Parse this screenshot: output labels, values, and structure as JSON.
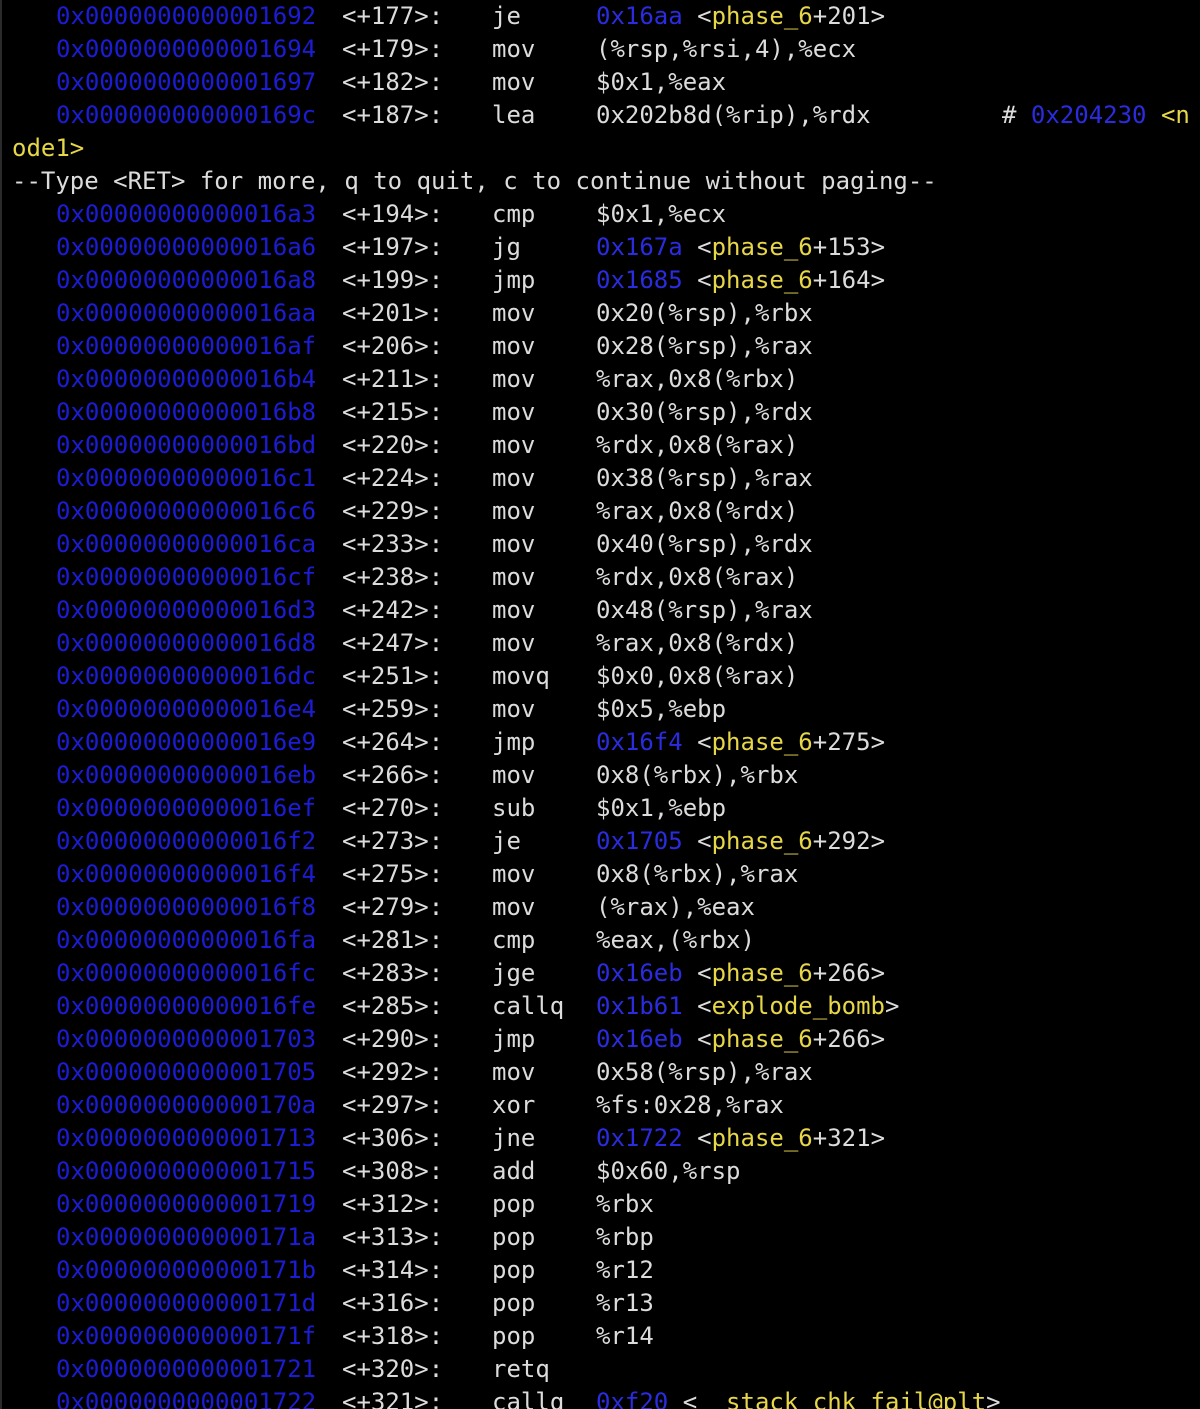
{
  "terminal": {
    "lines": [
      {
        "kind": "asm",
        "addr": "0x0000000000001692",
        "off": "<+177>:",
        "mnem": "je",
        "target": "0x16aa",
        "sym": "phase_6",
        "symoff": "+201>"
      },
      {
        "kind": "asm",
        "addr": "0x0000000000001694",
        "off": "<+179>:",
        "mnem": "mov",
        "ops": "(%rsp,%rsi,4),%ecx"
      },
      {
        "kind": "asm",
        "addr": "0x0000000000001697",
        "off": "<+182>:",
        "mnem": "mov",
        "ops": "$0x1,%eax"
      },
      {
        "kind": "asm",
        "addr": "0x000000000000169c",
        "off": "<+187>:",
        "mnem": "lea",
        "ops": "0x202b8d(%rip),%rdx",
        "comment_hash": "#",
        "comment_addr": "0x204230",
        "comment_sym": "<n"
      },
      {
        "kind": "wrap",
        "text": "ode1>"
      },
      {
        "kind": "plain",
        "text": "--Type <RET> for more, q to quit, c to continue without paging--"
      },
      {
        "kind": "asm",
        "addr": "0x00000000000016a3",
        "off": "<+194>:",
        "mnem": "cmp",
        "ops": "$0x1,%ecx"
      },
      {
        "kind": "asm",
        "addr": "0x00000000000016a6",
        "off": "<+197>:",
        "mnem": "jg",
        "target": "0x167a",
        "sym": "phase_6",
        "symoff": "+153>"
      },
      {
        "kind": "asm",
        "addr": "0x00000000000016a8",
        "off": "<+199>:",
        "mnem": "jmp",
        "target": "0x1685",
        "sym": "phase_6",
        "symoff": "+164>"
      },
      {
        "kind": "asm",
        "addr": "0x00000000000016aa",
        "off": "<+201>:",
        "mnem": "mov",
        "ops": "0x20(%rsp),%rbx"
      },
      {
        "kind": "asm",
        "addr": "0x00000000000016af",
        "off": "<+206>:",
        "mnem": "mov",
        "ops": "0x28(%rsp),%rax"
      },
      {
        "kind": "asm",
        "addr": "0x00000000000016b4",
        "off": "<+211>:",
        "mnem": "mov",
        "ops": "%rax,0x8(%rbx)"
      },
      {
        "kind": "asm",
        "addr": "0x00000000000016b8",
        "off": "<+215>:",
        "mnem": "mov",
        "ops": "0x30(%rsp),%rdx"
      },
      {
        "kind": "asm",
        "addr": "0x00000000000016bd",
        "off": "<+220>:",
        "mnem": "mov",
        "ops": "%rdx,0x8(%rax)"
      },
      {
        "kind": "asm",
        "addr": "0x00000000000016c1",
        "off": "<+224>:",
        "mnem": "mov",
        "ops": "0x38(%rsp),%rax"
      },
      {
        "kind": "asm",
        "addr": "0x00000000000016c6",
        "off": "<+229>:",
        "mnem": "mov",
        "ops": "%rax,0x8(%rdx)"
      },
      {
        "kind": "asm",
        "addr": "0x00000000000016ca",
        "off": "<+233>:",
        "mnem": "mov",
        "ops": "0x40(%rsp),%rdx"
      },
      {
        "kind": "asm",
        "addr": "0x00000000000016cf",
        "off": "<+238>:",
        "mnem": "mov",
        "ops": "%rdx,0x8(%rax)"
      },
      {
        "kind": "asm",
        "addr": "0x00000000000016d3",
        "off": "<+242>:",
        "mnem": "mov",
        "ops": "0x48(%rsp),%rax"
      },
      {
        "kind": "asm",
        "addr": "0x00000000000016d8",
        "off": "<+247>:",
        "mnem": "mov",
        "ops": "%rax,0x8(%rdx)"
      },
      {
        "kind": "asm",
        "addr": "0x00000000000016dc",
        "off": "<+251>:",
        "mnem": "movq",
        "ops": "$0x0,0x8(%rax)"
      },
      {
        "kind": "asm",
        "addr": "0x00000000000016e4",
        "off": "<+259>:",
        "mnem": "mov",
        "ops": "$0x5,%ebp"
      },
      {
        "kind": "asm",
        "addr": "0x00000000000016e9",
        "off": "<+264>:",
        "mnem": "jmp",
        "target": "0x16f4",
        "sym": "phase_6",
        "symoff": "+275>"
      },
      {
        "kind": "asm",
        "addr": "0x00000000000016eb",
        "off": "<+266>:",
        "mnem": "mov",
        "ops": "0x8(%rbx),%rbx"
      },
      {
        "kind": "asm",
        "addr": "0x00000000000016ef",
        "off": "<+270>:",
        "mnem": "sub",
        "ops": "$0x1,%ebp"
      },
      {
        "kind": "asm",
        "addr": "0x00000000000016f2",
        "off": "<+273>:",
        "mnem": "je",
        "target": "0x1705",
        "sym": "phase_6",
        "symoff": "+292>"
      },
      {
        "kind": "asm",
        "addr": "0x00000000000016f4",
        "off": "<+275>:",
        "mnem": "mov",
        "ops": "0x8(%rbx),%rax"
      },
      {
        "kind": "asm",
        "addr": "0x00000000000016f8",
        "off": "<+279>:",
        "mnem": "mov",
        "ops": "(%rax),%eax"
      },
      {
        "kind": "asm",
        "addr": "0x00000000000016fa",
        "off": "<+281>:",
        "mnem": "cmp",
        "ops": "%eax,(%rbx)"
      },
      {
        "kind": "asm",
        "addr": "0x00000000000016fc",
        "off": "<+283>:",
        "mnem": "jge",
        "target": "0x16eb",
        "sym": "phase_6",
        "symoff": "+266>"
      },
      {
        "kind": "asm",
        "addr": "0x00000000000016fe",
        "off": "<+285>:",
        "mnem": "callq",
        "target": "0x1b61",
        "sym": "explode_bomb",
        "symoff": ">"
      },
      {
        "kind": "asm",
        "addr": "0x0000000000001703",
        "off": "<+290>:",
        "mnem": "jmp",
        "target": "0x16eb",
        "sym": "phase_6",
        "symoff": "+266>"
      },
      {
        "kind": "asm",
        "addr": "0x0000000000001705",
        "off": "<+292>:",
        "mnem": "mov",
        "ops": "0x58(%rsp),%rax"
      },
      {
        "kind": "asm",
        "addr": "0x000000000000170a",
        "off": "<+297>:",
        "mnem": "xor",
        "ops": "%fs:0x28,%rax"
      },
      {
        "kind": "asm",
        "addr": "0x0000000000001713",
        "off": "<+306>:",
        "mnem": "jne",
        "target": "0x1722",
        "sym": "phase_6",
        "symoff": "+321>"
      },
      {
        "kind": "asm",
        "addr": "0x0000000000001715",
        "off": "<+308>:",
        "mnem": "add",
        "ops": "$0x60,%rsp"
      },
      {
        "kind": "asm",
        "addr": "0x0000000000001719",
        "off": "<+312>:",
        "mnem": "pop",
        "ops": "%rbx"
      },
      {
        "kind": "asm",
        "addr": "0x000000000000171a",
        "off": "<+313>:",
        "mnem": "pop",
        "ops": "%rbp"
      },
      {
        "kind": "asm",
        "addr": "0x000000000000171b",
        "off": "<+314>:",
        "mnem": "pop",
        "ops": "%r12"
      },
      {
        "kind": "asm",
        "addr": "0x000000000000171d",
        "off": "<+316>:",
        "mnem": "pop",
        "ops": "%r13"
      },
      {
        "kind": "asm",
        "addr": "0x000000000000171f",
        "off": "<+318>:",
        "mnem": "pop",
        "ops": "%r14"
      },
      {
        "kind": "asm",
        "addr": "0x0000000000001721",
        "off": "<+320>:",
        "mnem": "retq"
      },
      {
        "kind": "asm",
        "addr": "0x0000000000001722",
        "off": "<+321>:",
        "mnem": "callq",
        "target": "0xf20",
        "sym": "__stack_chk_fail@plt",
        "symoff": ">"
      }
    ]
  },
  "colors": {
    "background": "#000000",
    "text": "#dcdcdc",
    "address": "#1c1cd6",
    "symbol": "#e6d648"
  }
}
